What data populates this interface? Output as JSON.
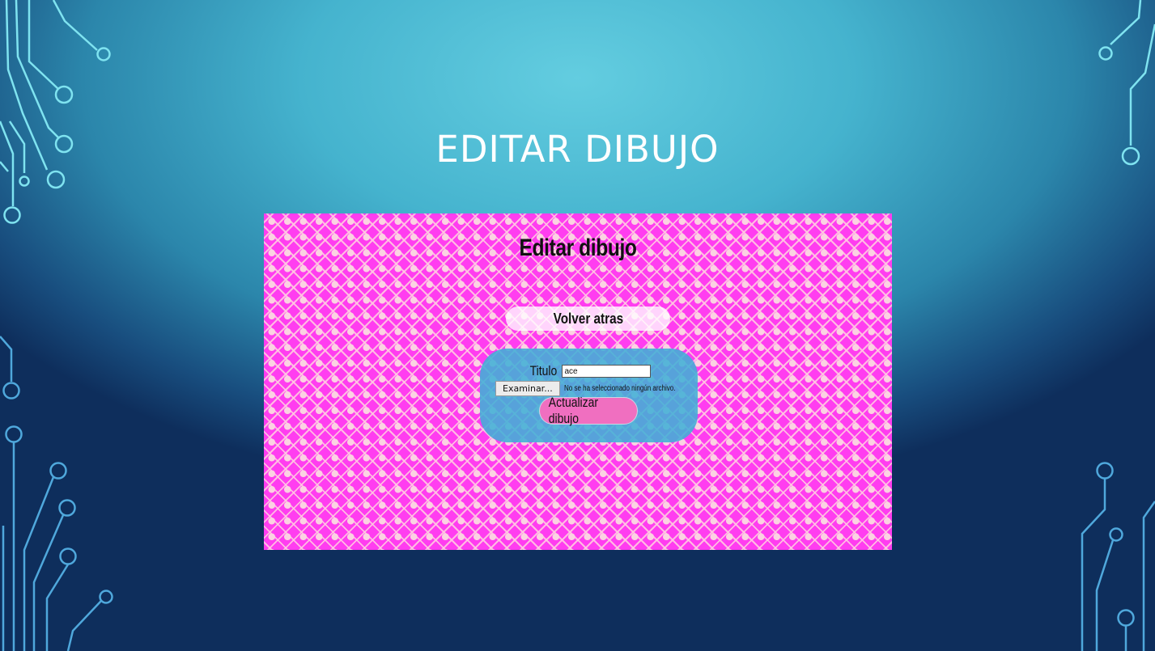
{
  "slide": {
    "title": "EDITAR DIBUJO"
  },
  "panel": {
    "heading": "Editar dibujo",
    "back_button_label": "Volver atras",
    "form": {
      "title_label": "Titulo",
      "title_value": "ace",
      "file_button_label": "Examinar...",
      "file_status": "No se ha seleccionado ningún archivo.",
      "submit_label": "Actualizar dibujo"
    }
  },
  "colors": {
    "panel_background": "#ff3df0",
    "form_background": "#40b0d6",
    "submit_button": "#f06fc0",
    "slide_title": "#ffffff"
  },
  "icons": {
    "decorations": [
      "circuit-left-top",
      "circuit-left-bottom",
      "circuit-right-top",
      "circuit-right-bottom"
    ]
  }
}
